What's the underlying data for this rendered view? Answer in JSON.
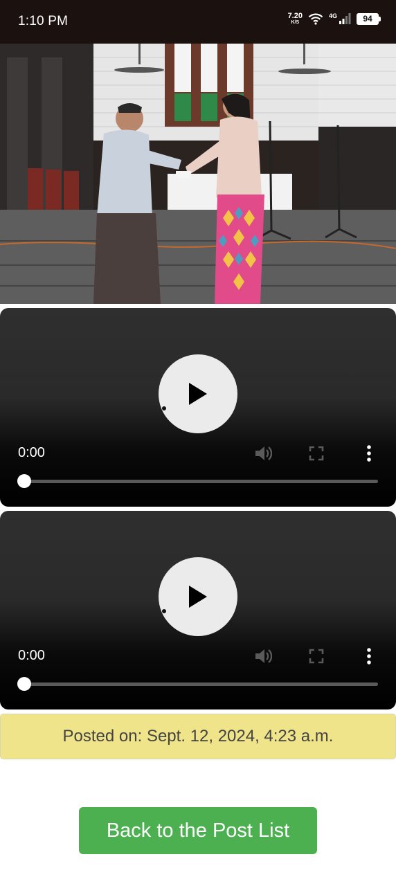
{
  "status_bar": {
    "time": "1:10 PM",
    "net_speed_value": "7.20",
    "net_speed_unit": "K/S",
    "network_label": "4G",
    "battery": "94",
    "icons": [
      "wifi-icon",
      "signal-icon",
      "battery-icon"
    ]
  },
  "photo": {
    "subject": "two-people-handshake-in-hall"
  },
  "videos": [
    {
      "time": "0:00",
      "progress": 0
    },
    {
      "time": "0:00",
      "progress": 0
    }
  ],
  "post": {
    "posted_on": "Posted on: Sept. 12, 2024, 4:23 a.m."
  },
  "actions": {
    "back_label": "Back to the Post List"
  },
  "colors": {
    "status_bar_bg": "#1b1210",
    "posted_bg": "#efe48a",
    "back_button_bg": "#4caf50"
  }
}
